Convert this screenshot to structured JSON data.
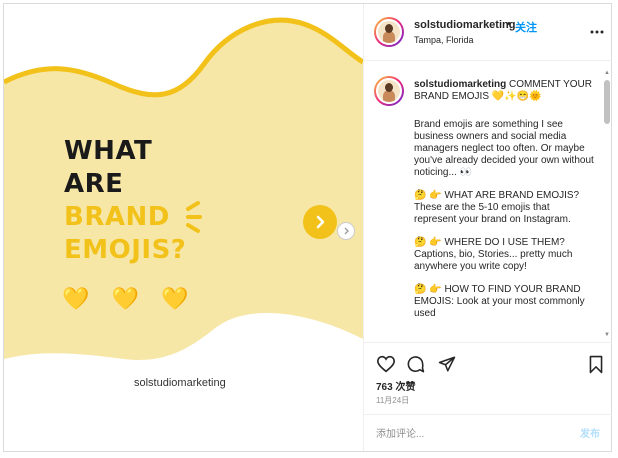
{
  "media": {
    "headline_line1": "WHAT",
    "headline_line2": "ARE",
    "headline_line3": "BRAND",
    "headline_line4": "EMOJIS?",
    "hearts": [
      "💛",
      "💛",
      "💛"
    ],
    "handle": "solstudiomarketing",
    "colors": {
      "background": "#f7e7a6",
      "accent": "#f2c21b",
      "text": "#1a1a1a"
    },
    "next_icon": "chevron-right-icon"
  },
  "header": {
    "username": "solstudiomarketing",
    "dot": "•",
    "follow_label": "关注",
    "location": "Tampa, Florida",
    "more_icon": "more-icon"
  },
  "caption": {
    "username": "solstudiomarketing",
    "title": "COMMENT YOUR BRAND EMOJIS 💛✨😁🌞",
    "p1": "Brand emojis are something I see business owners and social media managers neglect too often. Or maybe you've already decided your own without noticing... 👀",
    "p2": "🤔 👉 WHAT ARE BRAND EMOJIS? These are the 5-10 emojis that represent your brand on Instagram.",
    "p3": "🤔 👉 WHERE DO I USE THEM? Captions, bio, Stories... pretty much anywhere you write copy!",
    "p4": "🤔 👉 HOW TO FIND YOUR BRAND EMOJIS: Look at your most commonly used"
  },
  "actions": {
    "like_icon": "heart-icon",
    "comment_icon": "comment-icon",
    "share_icon": "share-icon",
    "save_icon": "bookmark-icon"
  },
  "likes": "763 次赞",
  "date": "11月24日",
  "add_comment": {
    "placeholder": "添加评论...",
    "post_label": "发布"
  }
}
